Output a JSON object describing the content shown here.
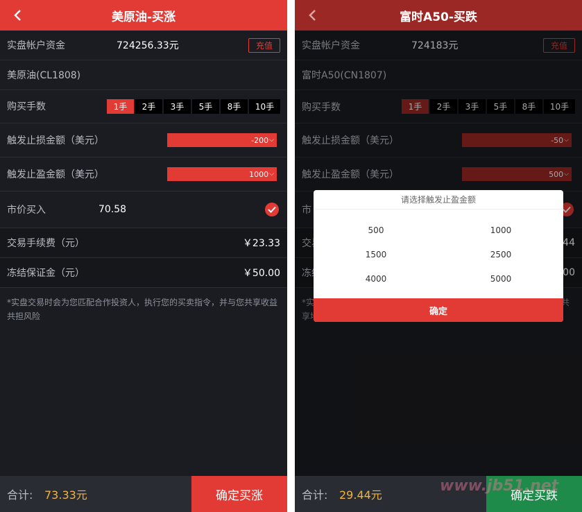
{
  "left": {
    "title": "美原油-买涨",
    "account_label": "实盘帐户资金",
    "balance": "724256.33元",
    "recharge": "充值",
    "product": "美原油(CL1808)",
    "lots_label": "购买手数",
    "lots": [
      "1手",
      "2手",
      "3手",
      "5手",
      "8手",
      "10手"
    ],
    "selected_lot": "1手",
    "stop_loss_label": "触发止损金额（美元）",
    "stop_loss_value": "-200",
    "take_profit_label": "触发止盈金额（美元）",
    "take_profit_value": "1000",
    "market_buy_label": "市价买入",
    "market_price": "70.58",
    "fee_label": "交易手续费（元）",
    "fee_value": "￥23.33",
    "margin_label": "冻结保证金（元）",
    "margin_value": "￥50.00",
    "note": "*实盘交易时会为您匹配合作投资人，执行您的买卖指令，并与您共享收益共担风险",
    "total_label": "合计:",
    "total_value": "73.33元",
    "confirm_label": "确定买涨"
  },
  "right": {
    "title": "富时A50-买跌",
    "account_label": "实盘帐户资金",
    "balance": "724183元",
    "recharge": "充值",
    "product": "富时A50(CN1807)",
    "lots_label": "购买手数",
    "lots": [
      "1手",
      "2手",
      "3手",
      "5手",
      "8手",
      "10手"
    ],
    "selected_lot": "1手",
    "stop_loss_label": "触发止损金额（美元）",
    "stop_loss_value": "-50",
    "take_profit_label": "触发止盈金额（美元）",
    "take_profit_value": "500",
    "market_buy_fragment": "市",
    "fee_label_fragment": "交易",
    "fee_value_fragment": "44",
    "margin_label_fragment": "冻结",
    "margin_value_fragment": "00",
    "note_fragment_1": "*实",
    "note_fragment_2": "享地",
    "note_fragment_3": "共",
    "total_label": "合计:",
    "total_value": "29.44元",
    "confirm_label": "确定买跌",
    "modal": {
      "title": "请选择触发止盈金额",
      "options": [
        "500",
        "1000",
        "1500",
        "2500",
        "4000",
        "5000"
      ],
      "confirm": "确定"
    }
  },
  "watermark": "www.jb51.net",
  "colors": {
    "accent": "#e23a35",
    "accent_dim": "#9b2825",
    "background": "#1b1c21",
    "total": "#f3b43b",
    "confirm_green": "#1f8b4a"
  }
}
